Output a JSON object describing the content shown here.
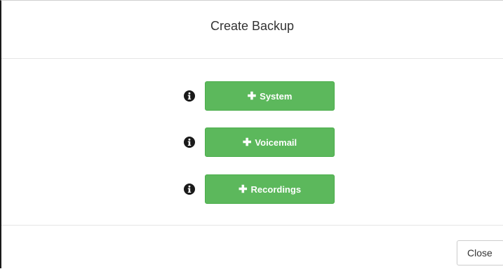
{
  "dialog": {
    "title": "Create Backup"
  },
  "backups": [
    {
      "label": "System",
      "icon": "plus-icon",
      "info_icon": "info-icon",
      "button_color": "#5cb85c"
    },
    {
      "label": "Voicemail",
      "icon": "plus-icon",
      "info_icon": "info-icon",
      "button_color": "#5cb85c"
    },
    {
      "label": "Recordings",
      "icon": "plus-icon",
      "info_icon": "info-icon",
      "button_color": "#5cb85c"
    }
  ],
  "footer": {
    "close_label": "Close"
  },
  "colors": {
    "accent_green": "#5cb85c",
    "info_icon": "#1a1a1a",
    "title_text": "#333333"
  }
}
